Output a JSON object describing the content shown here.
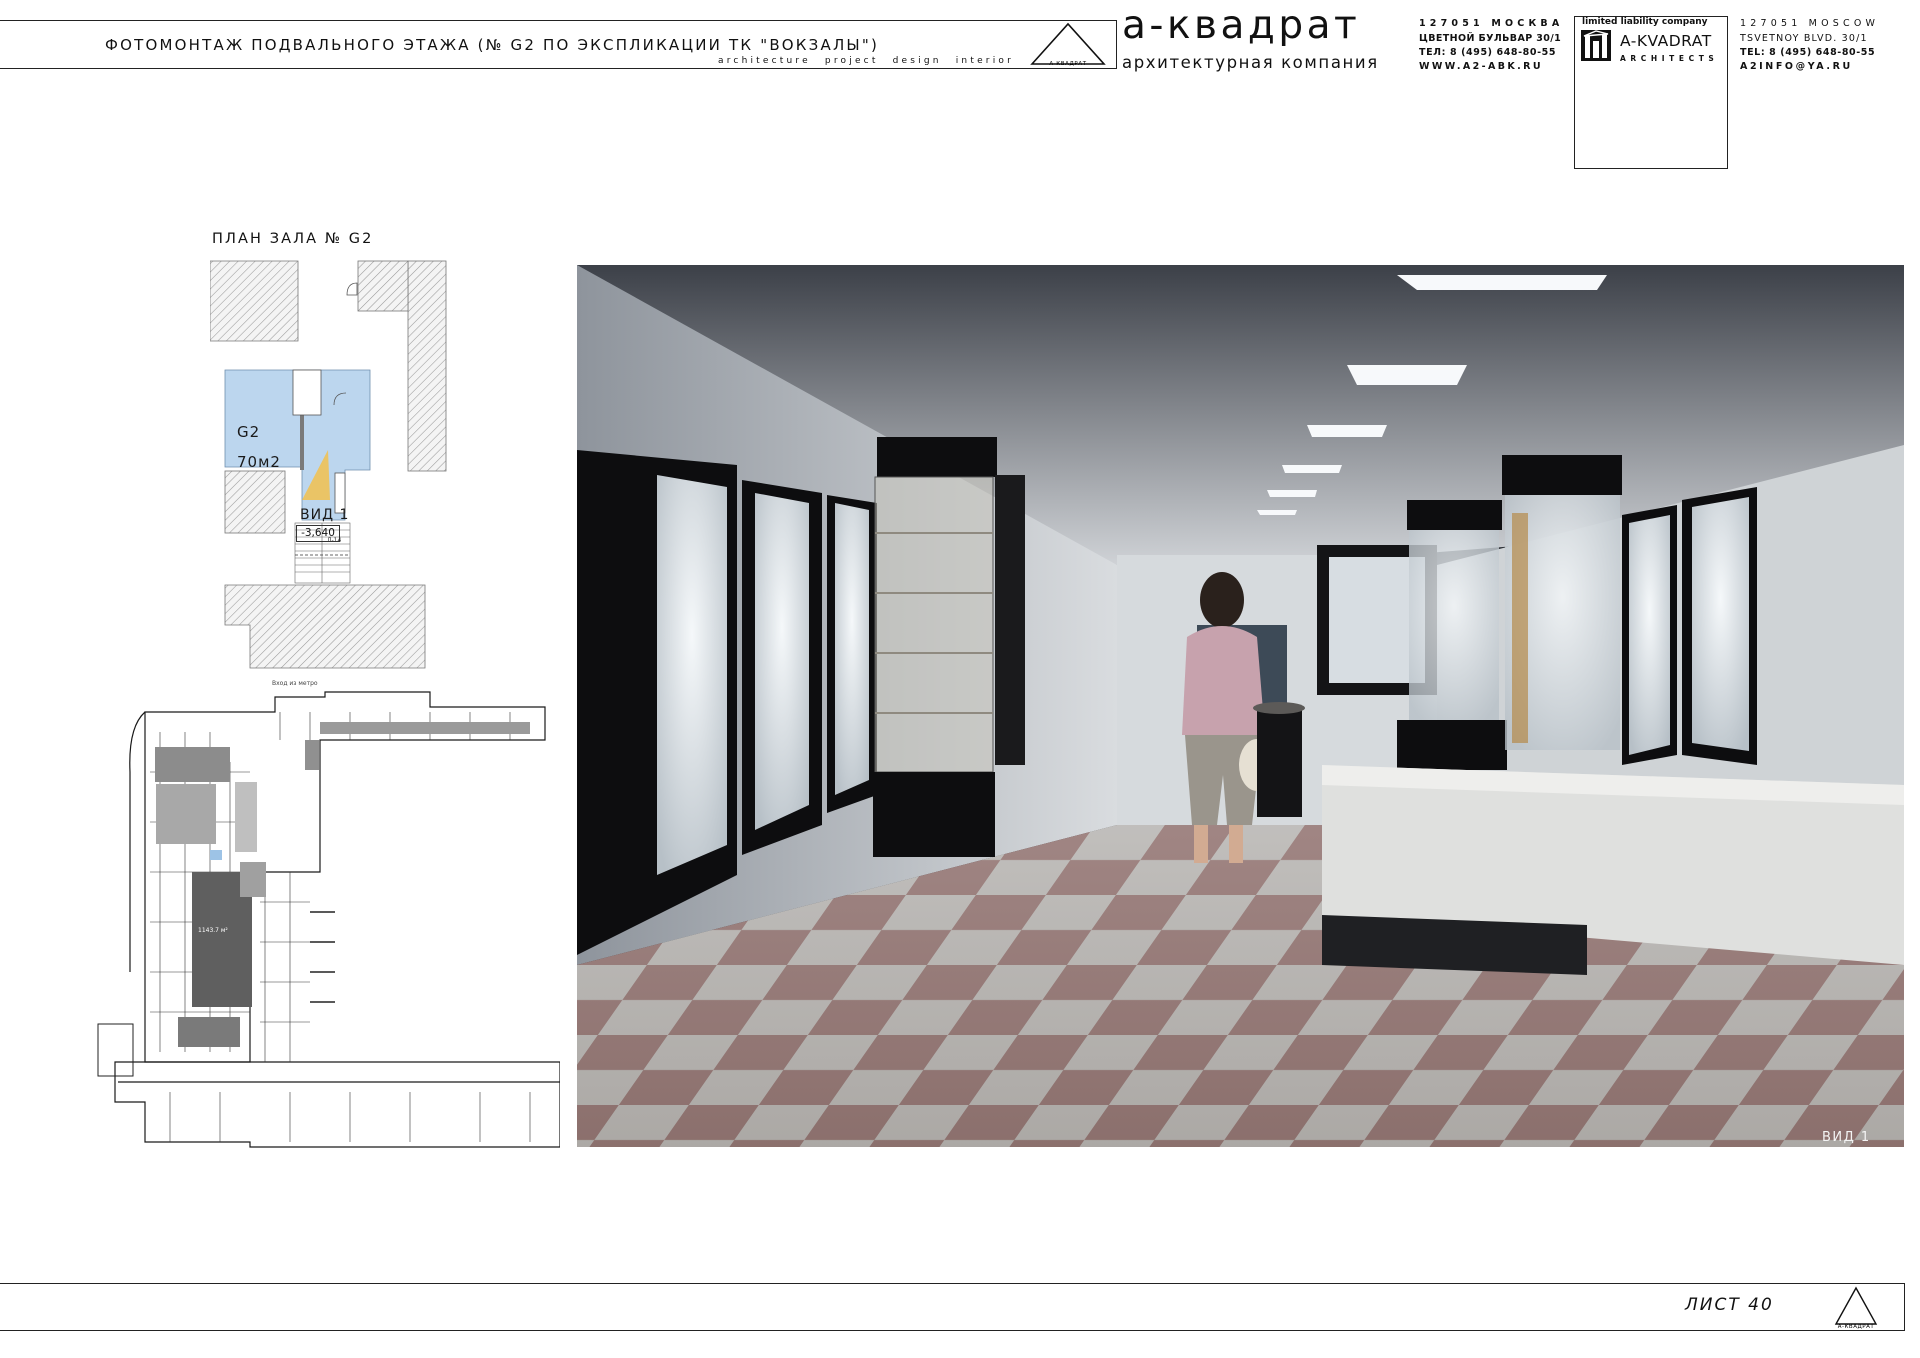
{
  "title_block": {
    "sheet_title": "ФОТОМОНТАЖ ПОДВАЛЬНОГО ЭТАЖА (№ G2 ПО ЭКСПЛИКАЦИИ ТК \"ВОКЗАЛЫ\")",
    "tagline": "architecture project design interior",
    "logo_caption": "А-КВАДРАТ",
    "brand_name": "а-квадрат",
    "brand_subtitle": "архитектурная компания",
    "address_ru": [
      "127051 МОСКВА",
      "ЦВЕТНОЙ БУЛЬВАР 30/1",
      "ТЕЛ: 8 (495) 648-80-55",
      "WWW.A2-ABK.RU"
    ],
    "llc_label": "limited liability company",
    "llc_name": "A-KVADRAT",
    "llc_subtitle": "ARCHITECTS",
    "address_en": [
      "127051 MOSCOW",
      "TSVETNOY BLVD. 30/1",
      "TEL: 8 (495) 648-80-55",
      "A2INFO@YA.RU"
    ]
  },
  "plan": {
    "title": "ПЛАН ЗАЛА № G2",
    "room_id": "G2",
    "room_area": "70м2",
    "view_label": "ВИД 1",
    "level_mark": "-3,640",
    "stair_mark": "Л-14",
    "entry_note": "Вход из метро"
  },
  "photo": {
    "view_label": "ВИД 1"
  },
  "footer": {
    "sheet_number": "ЛИСТ 40",
    "logo_caption": "А-КВАДРАТ"
  },
  "colors": {
    "room_fill": "#bcd6ee",
    "view_cone": "#f2c14e",
    "hatch": "#9a9a9a",
    "plan_dark": "#6b6b6b"
  }
}
